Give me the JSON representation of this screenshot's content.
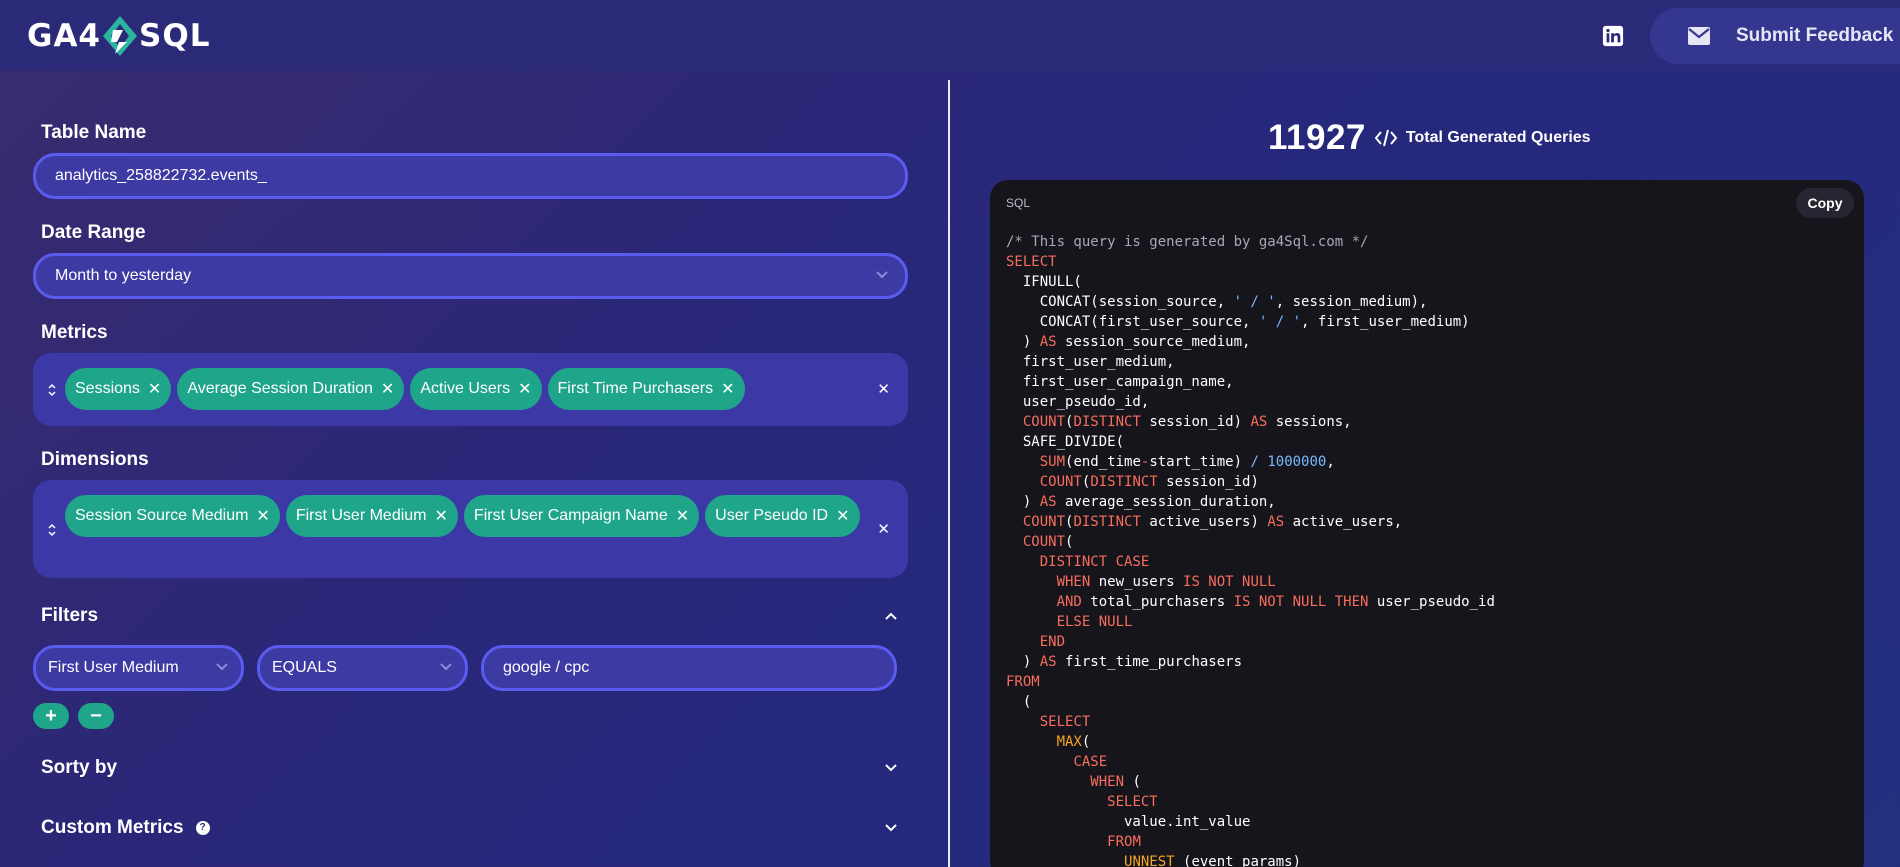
{
  "header": {
    "logo_left": "GA4",
    "logo_right": "SQL",
    "feedback_label": "Submit Feedback",
    "icons": {
      "logo_mark": "ga4sql-diamond-icon",
      "linkedin": "linkedin-icon",
      "mail": "envelope-icon"
    }
  },
  "form": {
    "table_name": {
      "label": "Table Name",
      "value": "analytics_258822732.events_"
    },
    "date_range": {
      "label": "Date Range",
      "value": "Month to yesterday"
    },
    "metrics": {
      "label": "Metrics",
      "selected": [
        "Sessions",
        "Average Session Duration",
        "Active Users",
        "First Time Purchasers"
      ]
    },
    "dimensions": {
      "label": "Dimensions",
      "selected": [
        "Session Source Medium",
        "First User Medium",
        "First User Campaign Name",
        "User Pseudo ID"
      ]
    },
    "filters": {
      "label": "Filters",
      "field": "First User Medium",
      "operator": "EQUALS",
      "value": "google / cpc",
      "add_label": "+",
      "remove_label": "−"
    },
    "sort_by": {
      "label": "Sorty by"
    },
    "custom_metrics": {
      "label": "Custom Metrics"
    }
  },
  "stats": {
    "total_queries": "11927",
    "total_label": "Total Generated Queries"
  },
  "code": {
    "language": "SQL",
    "copy_label": "Copy"
  },
  "colors": {
    "accent_teal": "#1fa58a",
    "input_border": "#5a5cf0",
    "code_bg": "#16151c",
    "keyword": "#f76d5b",
    "string": "#79b8ff"
  }
}
